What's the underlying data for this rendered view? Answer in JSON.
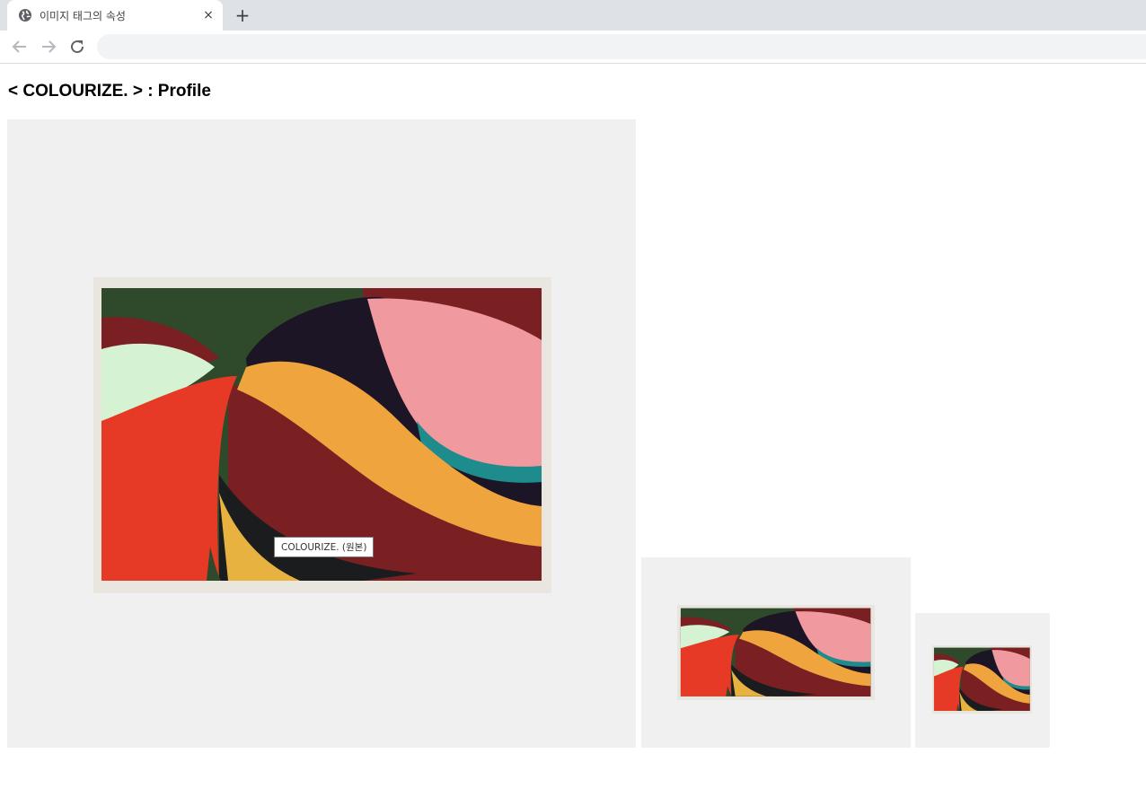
{
  "browser": {
    "tab": {
      "title": "이미지 태그의 속성",
      "favicon": "globe-icon",
      "close": "×"
    },
    "new_tab": "+",
    "toolbar": {
      "back": "arrow-left-icon",
      "forward": "arrow-right-icon",
      "reload": "reload-icon",
      "address": ""
    }
  },
  "page": {
    "heading": "< COLOURIZE. > : Profile",
    "tooltip": "COLOURIZE. (원본)",
    "images": [
      {
        "name": "original",
        "alt": "COLOURIZE."
      },
      {
        "name": "medium",
        "alt": "COLOURIZE."
      },
      {
        "name": "small",
        "alt": "COLOURIZE."
      }
    ]
  },
  "colors": {
    "tabstrip": "#dee1e6",
    "frame_bg": "#f0f0f0",
    "art_dark_green": "#2f4a2a",
    "art_maroon": "#7a1f22",
    "art_navy": "#1c1526",
    "art_pink": "#f09aa0",
    "art_mint": "#d5f2d2",
    "art_red": "#e63a26",
    "art_orange": "#f0a43e",
    "art_teal": "#1e8c8c"
  }
}
